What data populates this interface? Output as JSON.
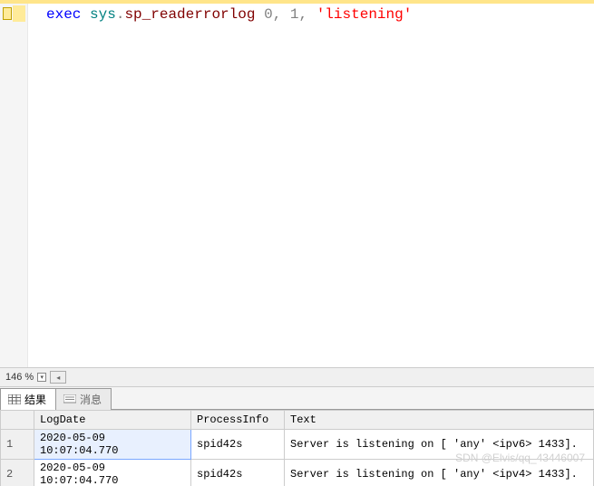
{
  "editor": {
    "tokens": {
      "exec": "exec",
      "sys": "sys",
      "dot": ".",
      "proc": "sp_readerrorlog",
      "sp1": " ",
      "zero": "0",
      "comma1": ", ",
      "one": "1",
      "comma2": ", ",
      "str": "'listening'"
    }
  },
  "zoom": {
    "value": "146 %"
  },
  "tabs": {
    "results": "结果",
    "messages": "消息"
  },
  "grid": {
    "headers": {
      "logdate": "LogDate",
      "procinfo": "ProcessInfo",
      "text": "Text"
    },
    "rows": [
      {
        "n": "1",
        "logdate": "2020-05-09 10:07:04.770",
        "procinfo": "spid42s",
        "text": "Server is listening on [ 'any' <ipv6> 1433]."
      },
      {
        "n": "2",
        "logdate": "2020-05-09 10:07:04.770",
        "procinfo": "spid42s",
        "text": "Server is listening on [ 'any' <ipv4> 1433]."
      }
    ]
  },
  "watermark": "SDN @Elvis/qq_43446007",
  "chart_data": {
    "type": "table",
    "title": "exec sys.sp_readerrorlog 0, 1, 'listening'",
    "columns": [
      "LogDate",
      "ProcessInfo",
      "Text"
    ],
    "rows": [
      [
        "2020-05-09 10:07:04.770",
        "spid42s",
        "Server is listening on [ 'any' <ipv6> 1433]."
      ],
      [
        "2020-05-09 10:07:04.770",
        "spid42s",
        "Server is listening on [ 'any' <ipv4> 1433]."
      ]
    ]
  }
}
